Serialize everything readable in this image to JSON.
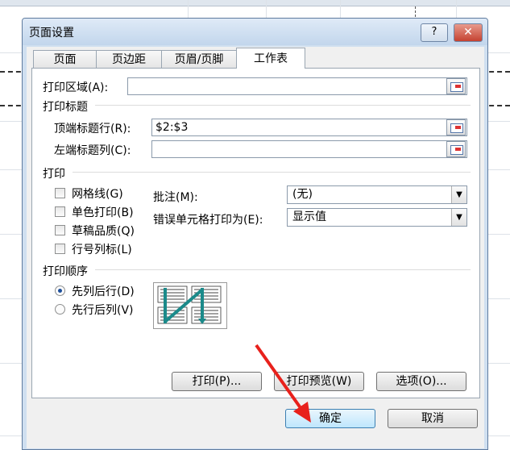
{
  "dialog": {
    "title": "页面设置",
    "help_label": "?",
    "close_label": "✕"
  },
  "tabs": [
    {
      "label": "页面"
    },
    {
      "label": "页边距"
    },
    {
      "label": "页眉/页脚"
    },
    {
      "label": "工作表"
    }
  ],
  "print_area": {
    "label": "打印区域(A):",
    "value": ""
  },
  "print_titles": {
    "heading": "打印标题",
    "rows_label": "顶端标题行(R):",
    "rows_value": "$2:$3",
    "cols_label": "左端标题列(C):",
    "cols_value": ""
  },
  "print": {
    "heading": "打印",
    "checkboxes": [
      {
        "label": "网格线(G)",
        "checked": false
      },
      {
        "label": "单色打印(B)",
        "checked": false
      },
      {
        "label": "草稿品质(Q)",
        "checked": false
      },
      {
        "label": "行号列标(L)",
        "checked": false
      }
    ],
    "comments_label": "批注(M):",
    "comments_value": "(无)",
    "errors_label": "错误单元格打印为(E):",
    "errors_value": "显示值"
  },
  "page_order": {
    "heading": "打印顺序",
    "options": [
      {
        "label": "先列后行(D)",
        "selected": true
      },
      {
        "label": "先行后列(V)",
        "selected": false
      }
    ]
  },
  "buttons": {
    "print": "打印(P)...",
    "preview": "打印预览(W)",
    "options": "选项(O)...",
    "ok": "确定",
    "cancel": "取消"
  },
  "colors": {
    "annotation_arrow": "#e8211c",
    "order_arrow": "#1b8a8a"
  }
}
